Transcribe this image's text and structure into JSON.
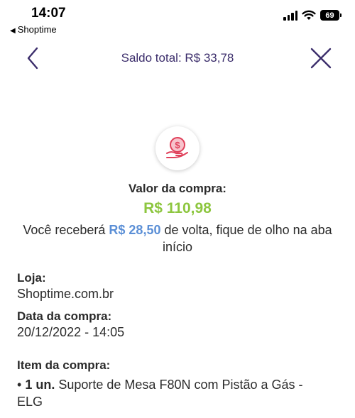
{
  "status_bar": {
    "time": "14:07",
    "back_app": "Shoptime",
    "battery": "69",
    "icons": [
      "signal-icon",
      "wifi-icon",
      "battery-icon"
    ]
  },
  "header": {
    "title": "Saldo total: R$ 33,78",
    "back_icon": "chevron-left-icon",
    "close_icon": "close-icon",
    "accent_color": "#3b2d6b"
  },
  "purchase": {
    "icon": "hand-coin-icon",
    "icon_color": "#e0405a",
    "label": "Valor da compra:",
    "amount": "R$ 110,98",
    "amount_color": "#8dc63f",
    "cashback_prefix": "Você receberá",
    "cashback_amount": "R$ 28,50",
    "cashback_suffix": "de volta, fique de olho na aba início",
    "cashback_color": "#5b8fd6"
  },
  "details": {
    "store_label": "Loja:",
    "store_value": "Shoptime.com.br",
    "date_label": "Data da compra:",
    "date_value": "20/12/2022 - 14:05",
    "item_label": "Item da compra:",
    "item_bullet": "•",
    "item_qty": "1 un.",
    "item_name": "Suporte de Mesa F80N com Pistão a Gás - ELG"
  }
}
